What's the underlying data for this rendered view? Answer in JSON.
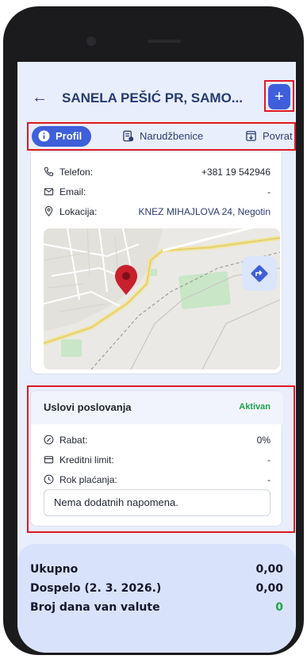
{
  "header": {
    "title": "SANELA PEŠIĆ PR, SAMO...",
    "add_label": "+",
    "back_label": "←"
  },
  "tabs": [
    {
      "label": "Profil",
      "icon": "info-icon",
      "active": true
    },
    {
      "label": "Narudžbenice",
      "icon": "orders-icon",
      "active": false
    },
    {
      "label": "Povrat",
      "icon": "return-icon",
      "active": false
    }
  ],
  "contact": {
    "phone_label": "Telefon:",
    "phone_value": "+381 19 542946",
    "email_label": "Email:",
    "email_value": "-",
    "location_label": "Lokacija:",
    "location_value": "KNEZ MIHAJLOVA 24, Negotin"
  },
  "terms": {
    "title": "Uslovi poslovanja",
    "status": "Aktivan",
    "discount_label": "Rabat:",
    "discount_value": "0%",
    "credit_label": "Kreditni limit:",
    "credit_value": "-",
    "payment_label": "Rok plaćanja:",
    "payment_value": "-",
    "note": "Nema dodatnih napomena."
  },
  "summary": {
    "total_label": "Ukupno",
    "total_value": "0,00",
    "due_label": "Dospelo (2. 3. 2026.)",
    "due_value": "0,00",
    "days_label": "Broj dana van valute",
    "days_value": "0"
  },
  "colors": {
    "accent": "#3e5fd9",
    "highlight": "#e01827",
    "success": "#1fa34a"
  }
}
